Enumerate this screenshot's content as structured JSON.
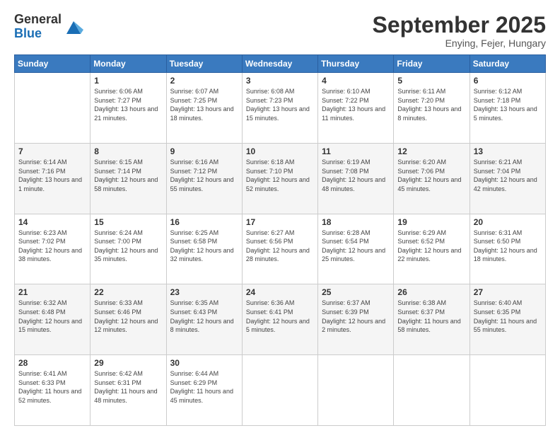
{
  "logo": {
    "general": "General",
    "blue": "Blue"
  },
  "header": {
    "month": "September 2025",
    "location": "Enying, Fejer, Hungary"
  },
  "weekdays": [
    "Sunday",
    "Monday",
    "Tuesday",
    "Wednesday",
    "Thursday",
    "Friday",
    "Saturday"
  ],
  "weeks": [
    [
      {
        "day": "",
        "sunrise": "",
        "sunset": "",
        "daylight": ""
      },
      {
        "day": "1",
        "sunrise": "Sunrise: 6:06 AM",
        "sunset": "Sunset: 7:27 PM",
        "daylight": "Daylight: 13 hours and 21 minutes."
      },
      {
        "day": "2",
        "sunrise": "Sunrise: 6:07 AM",
        "sunset": "Sunset: 7:25 PM",
        "daylight": "Daylight: 13 hours and 18 minutes."
      },
      {
        "day": "3",
        "sunrise": "Sunrise: 6:08 AM",
        "sunset": "Sunset: 7:23 PM",
        "daylight": "Daylight: 13 hours and 15 minutes."
      },
      {
        "day": "4",
        "sunrise": "Sunrise: 6:10 AM",
        "sunset": "Sunset: 7:22 PM",
        "daylight": "Daylight: 13 hours and 11 minutes."
      },
      {
        "day": "5",
        "sunrise": "Sunrise: 6:11 AM",
        "sunset": "Sunset: 7:20 PM",
        "daylight": "Daylight: 13 hours and 8 minutes."
      },
      {
        "day": "6",
        "sunrise": "Sunrise: 6:12 AM",
        "sunset": "Sunset: 7:18 PM",
        "daylight": "Daylight: 13 hours and 5 minutes."
      }
    ],
    [
      {
        "day": "7",
        "sunrise": "Sunrise: 6:14 AM",
        "sunset": "Sunset: 7:16 PM",
        "daylight": "Daylight: 13 hours and 1 minute."
      },
      {
        "day": "8",
        "sunrise": "Sunrise: 6:15 AM",
        "sunset": "Sunset: 7:14 PM",
        "daylight": "Daylight: 12 hours and 58 minutes."
      },
      {
        "day": "9",
        "sunrise": "Sunrise: 6:16 AM",
        "sunset": "Sunset: 7:12 PM",
        "daylight": "Daylight: 12 hours and 55 minutes."
      },
      {
        "day": "10",
        "sunrise": "Sunrise: 6:18 AM",
        "sunset": "Sunset: 7:10 PM",
        "daylight": "Daylight: 12 hours and 52 minutes."
      },
      {
        "day": "11",
        "sunrise": "Sunrise: 6:19 AM",
        "sunset": "Sunset: 7:08 PM",
        "daylight": "Daylight: 12 hours and 48 minutes."
      },
      {
        "day": "12",
        "sunrise": "Sunrise: 6:20 AM",
        "sunset": "Sunset: 7:06 PM",
        "daylight": "Daylight: 12 hours and 45 minutes."
      },
      {
        "day": "13",
        "sunrise": "Sunrise: 6:21 AM",
        "sunset": "Sunset: 7:04 PM",
        "daylight": "Daylight: 12 hours and 42 minutes."
      }
    ],
    [
      {
        "day": "14",
        "sunrise": "Sunrise: 6:23 AM",
        "sunset": "Sunset: 7:02 PM",
        "daylight": "Daylight: 12 hours and 38 minutes."
      },
      {
        "day": "15",
        "sunrise": "Sunrise: 6:24 AM",
        "sunset": "Sunset: 7:00 PM",
        "daylight": "Daylight: 12 hours and 35 minutes."
      },
      {
        "day": "16",
        "sunrise": "Sunrise: 6:25 AM",
        "sunset": "Sunset: 6:58 PM",
        "daylight": "Daylight: 12 hours and 32 minutes."
      },
      {
        "day": "17",
        "sunrise": "Sunrise: 6:27 AM",
        "sunset": "Sunset: 6:56 PM",
        "daylight": "Daylight: 12 hours and 28 minutes."
      },
      {
        "day": "18",
        "sunrise": "Sunrise: 6:28 AM",
        "sunset": "Sunset: 6:54 PM",
        "daylight": "Daylight: 12 hours and 25 minutes."
      },
      {
        "day": "19",
        "sunrise": "Sunrise: 6:29 AM",
        "sunset": "Sunset: 6:52 PM",
        "daylight": "Daylight: 12 hours and 22 minutes."
      },
      {
        "day": "20",
        "sunrise": "Sunrise: 6:31 AM",
        "sunset": "Sunset: 6:50 PM",
        "daylight": "Daylight: 12 hours and 18 minutes."
      }
    ],
    [
      {
        "day": "21",
        "sunrise": "Sunrise: 6:32 AM",
        "sunset": "Sunset: 6:48 PM",
        "daylight": "Daylight: 12 hours and 15 minutes."
      },
      {
        "day": "22",
        "sunrise": "Sunrise: 6:33 AM",
        "sunset": "Sunset: 6:46 PM",
        "daylight": "Daylight: 12 hours and 12 minutes."
      },
      {
        "day": "23",
        "sunrise": "Sunrise: 6:35 AM",
        "sunset": "Sunset: 6:43 PM",
        "daylight": "Daylight: 12 hours and 8 minutes."
      },
      {
        "day": "24",
        "sunrise": "Sunrise: 6:36 AM",
        "sunset": "Sunset: 6:41 PM",
        "daylight": "Daylight: 12 hours and 5 minutes."
      },
      {
        "day": "25",
        "sunrise": "Sunrise: 6:37 AM",
        "sunset": "Sunset: 6:39 PM",
        "daylight": "Daylight: 12 hours and 2 minutes."
      },
      {
        "day": "26",
        "sunrise": "Sunrise: 6:38 AM",
        "sunset": "Sunset: 6:37 PM",
        "daylight": "Daylight: 11 hours and 58 minutes."
      },
      {
        "day": "27",
        "sunrise": "Sunrise: 6:40 AM",
        "sunset": "Sunset: 6:35 PM",
        "daylight": "Daylight: 11 hours and 55 minutes."
      }
    ],
    [
      {
        "day": "28",
        "sunrise": "Sunrise: 6:41 AM",
        "sunset": "Sunset: 6:33 PM",
        "daylight": "Daylight: 11 hours and 52 minutes."
      },
      {
        "day": "29",
        "sunrise": "Sunrise: 6:42 AM",
        "sunset": "Sunset: 6:31 PM",
        "daylight": "Daylight: 11 hours and 48 minutes."
      },
      {
        "day": "30",
        "sunrise": "Sunrise: 6:44 AM",
        "sunset": "Sunset: 6:29 PM",
        "daylight": "Daylight: 11 hours and 45 minutes."
      },
      {
        "day": "",
        "sunrise": "",
        "sunset": "",
        "daylight": ""
      },
      {
        "day": "",
        "sunrise": "",
        "sunset": "",
        "daylight": ""
      },
      {
        "day": "",
        "sunrise": "",
        "sunset": "",
        "daylight": ""
      },
      {
        "day": "",
        "sunrise": "",
        "sunset": "",
        "daylight": ""
      }
    ]
  ]
}
